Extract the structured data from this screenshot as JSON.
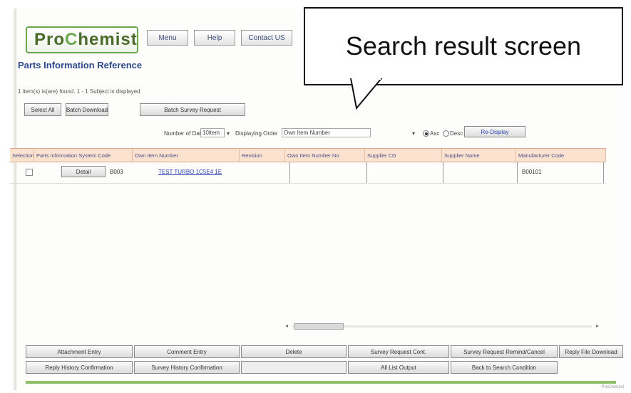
{
  "header": {
    "logo_pro": "Pro",
    "logo_c": "C",
    "logo_rest": "hemist",
    "menu_label": "Menu",
    "help_label": "Help",
    "contact_label": "Contact US"
  },
  "page_title": "Parts Information Reference",
  "result_note": "1 item(s) is(are) found. 1 - 1 Subject is displayed",
  "toolbar": {
    "select_all": "Select All",
    "batch_download": "Batch Download",
    "batch_survey": "Batch Survey Request"
  },
  "callout": {
    "text": "Search result screen"
  },
  "options": {
    "number_label": "Number of Data",
    "number_value": "10item",
    "order_label": "Displaying Order",
    "order_value": "Own Item Number",
    "asc_label": "Asc",
    "desc_label": "Desc",
    "sort_selected": "Asc",
    "redisplay": "Re-Display"
  },
  "table": {
    "columns": [
      "Selection",
      "Parts Information System Code",
      "Own Item Number",
      "Revision",
      "Own Item Number No",
      "Supplier CD",
      "Supplier Name",
      "Manufacturer Code"
    ],
    "rows": [
      {
        "detail": "Detail",
        "system_code": "B003",
        "own_item_number": "TEST TURBO 1C5E4 1E",
        "manufacturer_code": "B00101"
      }
    ]
  },
  "actions": {
    "attachment_entry": "Attachment Entry",
    "comment_entry": "Comment Entry",
    "delete": "Delete",
    "survey_request_cont": "Survey Request Cont.",
    "survey_request_remind": "Survey Request Remind/Cancel",
    "reply_file_download": "Reply File Download",
    "reply_history": "Reply History Confirmation",
    "survey_history": "Survey History Confirmation",
    "blank": "",
    "all_list_output": "All List Output",
    "back_to_search": "Back to Search Condition"
  },
  "footer": {
    "text": "ProChemist"
  }
}
